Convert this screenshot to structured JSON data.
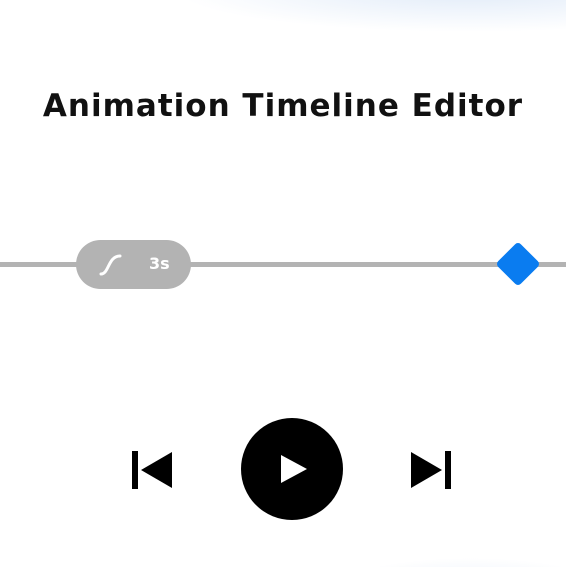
{
  "editor": {
    "title": "Animation Timeline Editor"
  },
  "timeline": {
    "segment": {
      "easing_icon": "ease-in-out-curve-icon",
      "duration": "3s"
    },
    "keyframe": {
      "icon": "diamond-keyframe-icon",
      "color": "#0a7cf0"
    },
    "track_color": "#b3b3b3"
  },
  "playback": {
    "skip_back_icon": "skip-to-start-icon",
    "play_icon": "play-icon",
    "skip_forward_icon": "skip-to-end-icon"
  }
}
